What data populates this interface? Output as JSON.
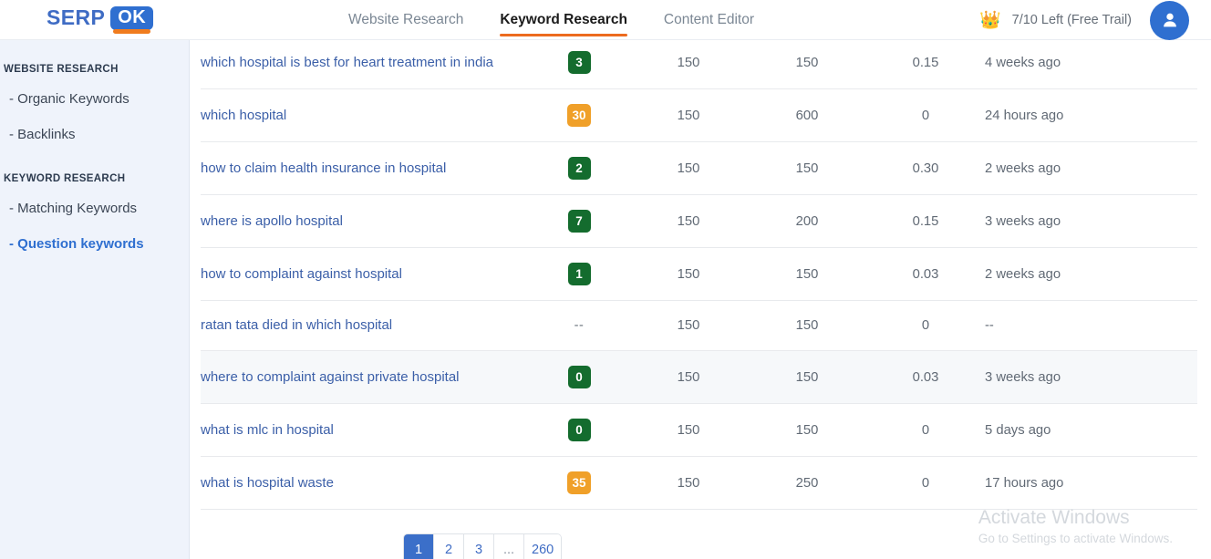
{
  "header": {
    "logo": {
      "serp": "SERP",
      "ok": "OK"
    },
    "nav": [
      {
        "label": "Website Research",
        "active": false
      },
      {
        "label": "Keyword Research",
        "active": true
      },
      {
        "label": "Content Editor",
        "active": false
      }
    ],
    "plan": {
      "crown_icon": "crown-icon",
      "text": "7/10 Left (Free Trail)"
    },
    "avatar_icon": "user-avatar-icon"
  },
  "sidebar": {
    "groups": [
      {
        "title": "WEBSITE RESEARCH",
        "items": [
          {
            "label": "- Organic Keywords",
            "active": false
          },
          {
            "label": "- Backlinks",
            "active": false
          }
        ]
      },
      {
        "title": "KEYWORD RESEARCH",
        "items": [
          {
            "label": "- Matching Keywords",
            "active": false
          },
          {
            "label": "- Question keywords",
            "active": true
          }
        ]
      }
    ]
  },
  "table": {
    "rows": [
      {
        "keyword": "which hospital is best for heart treatment in india",
        "difficulty": "3",
        "difficulty_level": "green",
        "volume": "150",
        "volume2": "150",
        "cpc": "0.15",
        "updated": "4 weeks ago",
        "highlight": false
      },
      {
        "keyword": "which hospital",
        "difficulty": "30",
        "difficulty_level": "orange",
        "volume": "150",
        "volume2": "600",
        "cpc": "0",
        "updated": "24 hours ago",
        "highlight": false
      },
      {
        "keyword": "how to claim health insurance in hospital",
        "difficulty": "2",
        "difficulty_level": "green",
        "volume": "150",
        "volume2": "150",
        "cpc": "0.30",
        "updated": "2 weeks ago",
        "highlight": false
      },
      {
        "keyword": "where is apollo hospital",
        "difficulty": "7",
        "difficulty_level": "green",
        "volume": "150",
        "volume2": "200",
        "cpc": "0.15",
        "updated": "3 weeks ago",
        "highlight": false
      },
      {
        "keyword": "how to complaint against hospital",
        "difficulty": "1",
        "difficulty_level": "green",
        "volume": "150",
        "volume2": "150",
        "cpc": "0.03",
        "updated": "2 weeks ago",
        "highlight": false
      },
      {
        "keyword": "ratan tata died in which hospital",
        "difficulty": "--",
        "difficulty_level": "none",
        "volume": "150",
        "volume2": "150",
        "cpc": "0",
        "updated": "--",
        "highlight": false
      },
      {
        "keyword": "where to complaint against private hospital",
        "difficulty": "0",
        "difficulty_level": "green",
        "volume": "150",
        "volume2": "150",
        "cpc": "0.03",
        "updated": "3 weeks ago",
        "highlight": true
      },
      {
        "keyword": "what is mlc in hospital",
        "difficulty": "0",
        "difficulty_level": "green",
        "volume": "150",
        "volume2": "150",
        "cpc": "0",
        "updated": "5 days ago",
        "highlight": false
      },
      {
        "keyword": "what is hospital waste",
        "difficulty": "35",
        "difficulty_level": "orange",
        "volume": "150",
        "volume2": "250",
        "cpc": "0",
        "updated": "17 hours ago",
        "highlight": false
      }
    ]
  },
  "pagination": {
    "pages": [
      {
        "label": "1",
        "active": true,
        "ellipsis": false
      },
      {
        "label": "2",
        "active": false,
        "ellipsis": false
      },
      {
        "label": "3",
        "active": false,
        "ellipsis": false
      },
      {
        "label": "...",
        "active": false,
        "ellipsis": true
      },
      {
        "label": "260",
        "active": false,
        "ellipsis": false
      }
    ]
  },
  "watermark": {
    "title": "Activate Windows",
    "subtitle": "Go to Settings to activate Windows."
  },
  "colors": {
    "accent_blue": "#2f6fd0",
    "accent_orange": "#ec6b1f",
    "difficulty_green": "#146c2e",
    "difficulty_orange": "#f0a029",
    "link_blue": "#3b5fa8",
    "sidebar_bg": "#eff3fb"
  }
}
